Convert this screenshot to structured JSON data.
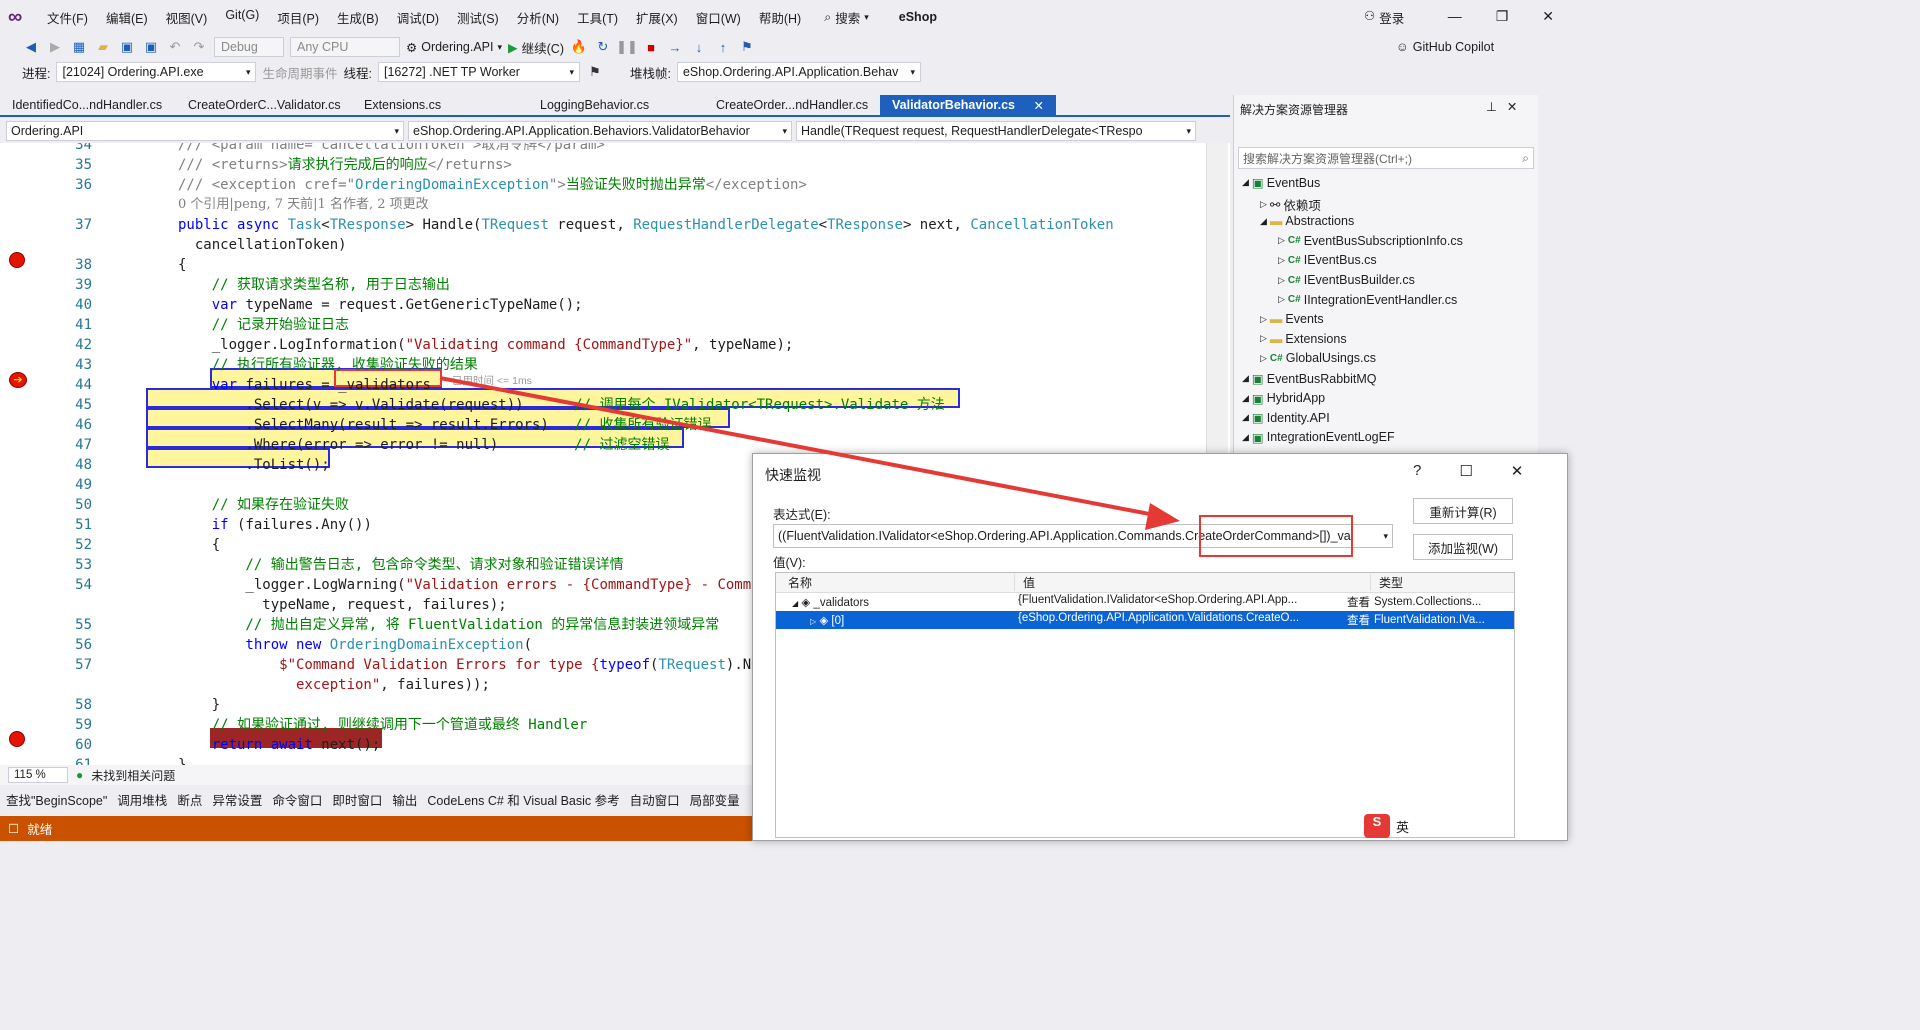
{
  "app": {
    "title": "eShop",
    "login": "登录",
    "copilot": "GitHub Copilot"
  },
  "menu": [
    "文件(F)",
    "编辑(E)",
    "视图(V)",
    "Git(G)",
    "项目(P)",
    "生成(B)",
    "调试(D)",
    "测试(S)",
    "分析(N)",
    "工具(T)",
    "扩展(X)",
    "窗口(W)",
    "帮助(H)"
  ],
  "search_label": "搜索",
  "toolbar": {
    "config": "Debug",
    "platform": "Any CPU",
    "startup": "Ordering.API",
    "continue": "继续(C)"
  },
  "debugbar": {
    "process_label": "进程:",
    "process": "[21024] Ordering.API.exe",
    "lifecycle": "生命周期事件",
    "thread_label": "线程:",
    "thread": "[16272] .NET TP Worker",
    "stack_label": "堆栈帧:",
    "stack": "eShop.Ordering.API.Application.Behav"
  },
  "tabs": [
    "IdentifiedCo...ndHandler.cs",
    "CreateOrderC...Validator.cs",
    "Extensions.cs",
    "LoggingBehavior.cs",
    "CreateOrder...ndHandler.cs",
    "ValidatorBehavior.cs"
  ],
  "nav": {
    "project": "Ordering.API",
    "type": "eShop.Ordering.API.Application.Behaviors.ValidatorBehavior",
    "member": "Handle(TRequest request, RequestHandlerDelegate<TRespo"
  },
  "editor": {
    "lines": [
      {
        "n": "34",
        "segs": [
          [
            "gy",
            "/// <param name=\"cancellationToken\">取消令牌</param>"
          ]
        ]
      },
      {
        "n": "35",
        "segs": [
          [
            "gy",
            "/// <returns>"
          ],
          [
            "cm",
            "请求执行完成后的响应"
          ],
          [
            "gy",
            "</returns>"
          ]
        ]
      },
      {
        "n": "36",
        "segs": [
          [
            "gy",
            "/// <exception cref=\""
          ],
          [
            "ty",
            "OrderingDomainException"
          ],
          [
            "gy",
            "\">"
          ],
          [
            "cm",
            "当验证失败时抛出异常"
          ],
          [
            "gy",
            "</exception>"
          ]
        ]
      },
      {
        "n": "",
        "segs": [
          [
            "gy",
            "0 个引用|peng, 7 天前|1 名作者, 2 项更改"
          ]
        ]
      },
      {
        "n": "37",
        "segs": [
          [
            "kw",
            "public async "
          ],
          [
            "ty",
            "Task"
          ],
          [
            "",
            "<"
          ],
          [
            "ty",
            "TResponse"
          ],
          [
            "",
            "> "
          ],
          [
            "",
            "Handle("
          ],
          [
            "ty",
            "TRequest"
          ],
          [
            "",
            " request, "
          ],
          [
            "ty",
            "RequestHandlerDelegate"
          ],
          [
            "",
            "<"
          ],
          [
            "ty",
            "TResponse"
          ],
          [
            "",
            "> next, "
          ],
          [
            "ty",
            "CancellationToken"
          ]
        ]
      },
      {
        "n": "",
        "segs": [
          [
            "",
            "  cancellationToken)"
          ]
        ]
      },
      {
        "n": "38",
        "segs": [
          [
            "",
            "{"
          ]
        ]
      },
      {
        "n": "39",
        "segs": [
          [
            "cm",
            "    // 获取请求类型名称, 用于日志输出"
          ]
        ]
      },
      {
        "n": "40",
        "segs": [
          [
            "kw",
            "    var "
          ],
          [
            "",
            "typeName = request.GetGenericTypeName();"
          ]
        ]
      },
      {
        "n": "41",
        "segs": [
          [
            "cm",
            "    // 记录开始验证日志"
          ]
        ]
      },
      {
        "n": "42",
        "segs": [
          [
            "",
            "    _logger.LogInformation("
          ],
          [
            "st",
            "\"Validating command {CommandType}\""
          ],
          [
            "",
            ", typeName);"
          ]
        ]
      },
      {
        "n": "43",
        "segs": [
          [
            "cm",
            "    // 执行所有验证器, 收集验证失败的结果"
          ]
        ]
      },
      {
        "n": "44",
        "segs": [
          [
            "kw",
            "    var "
          ],
          [
            "",
            "failures = _validators"
          ]
        ]
      },
      {
        "n": "45",
        "segs": [
          [
            "",
            "        .Select(v => v.Validate(request))      "
          ],
          [
            "cm",
            "// 调用每个 IValidator<TRequest>.Validate 方法"
          ]
        ]
      },
      {
        "n": "46",
        "segs": [
          [
            "",
            "        .SelectMany(result => result.Errors)   "
          ],
          [
            "cm",
            "// 收集所有验证错误"
          ]
        ]
      },
      {
        "n": "47",
        "segs": [
          [
            "",
            "        .Where(error => error != null)         "
          ],
          [
            "cm",
            "// 过滤空错误"
          ]
        ]
      },
      {
        "n": "48",
        "segs": [
          [
            "",
            "        .ToList();"
          ]
        ]
      },
      {
        "n": "49",
        "segs": [
          [
            "",
            ""
          ]
        ]
      },
      {
        "n": "50",
        "segs": [
          [
            "cm",
            "    // 如果存在验证失败"
          ]
        ]
      },
      {
        "n": "51",
        "segs": [
          [
            "kw",
            "    if "
          ],
          [
            "",
            "(failures.Any())"
          ]
        ]
      },
      {
        "n": "52",
        "segs": [
          [
            "",
            "    {"
          ]
        ]
      },
      {
        "n": "53",
        "segs": [
          [
            "cm",
            "        // 输出警告日志, 包含命令类型、请求对象和验证错误详情"
          ]
        ]
      },
      {
        "n": "54",
        "segs": [
          [
            "",
            "        _logger.LogWarning("
          ],
          [
            "st",
            "\"Validation errors - {CommandType} - Comm"
          ]
        ]
      },
      {
        "n": "",
        "segs": [
          [
            "",
            "          typeName, request, failures);"
          ]
        ]
      },
      {
        "n": "55",
        "segs": [
          [
            "cm",
            "        // 抛出自定义异常, 将 FluentValidation 的异常信息封装进领域异常"
          ]
        ]
      },
      {
        "n": "56",
        "segs": [
          [
            "kw",
            "        throw new "
          ],
          [
            "ty",
            "OrderingDomainException"
          ],
          [
            "",
            "("
          ]
        ]
      },
      {
        "n": "57",
        "segs": [
          [
            "st",
            "            $\"Command Validation Errors for type {"
          ],
          [
            "kw",
            "typeof"
          ],
          [
            "",
            "("
          ],
          [
            "ty",
            "TRequest"
          ],
          [
            "",
            ").N"
          ]
        ]
      },
      {
        "n": "",
        "segs": [
          [
            "st",
            "              exception\""
          ],
          [
            "",
            ", failures));"
          ]
        ]
      },
      {
        "n": "58",
        "segs": [
          [
            "",
            "    }"
          ]
        ]
      },
      {
        "n": "59",
        "segs": [
          [
            "cm",
            "    // 如果验证通过, 则继续调用下一个管道或最终 Handler"
          ]
        ]
      },
      {
        "n": "60",
        "segs": [
          [
            "kw",
            "    return await "
          ],
          [
            "",
            "next();"
          ]
        ]
      },
      {
        "n": "61",
        "segs": [
          [
            "",
            "}"
          ]
        ]
      }
    ],
    "elapsed": "已用时间 <= 1ms",
    "zoom": "115 %",
    "issues": "未找到相关问题"
  },
  "solution": {
    "title": "解决方案资源管理器",
    "search_placeholder": "搜索解决方案资源管理器(Ctrl+;)",
    "items": [
      {
        "label": "EventBus",
        "indent": 0,
        "kind": "proj"
      },
      {
        "label": "依赖项",
        "indent": 1,
        "kind": "dep"
      },
      {
        "label": "Abstractions",
        "indent": 1,
        "kind": "folder"
      },
      {
        "label": "EventBusSubscriptionInfo.cs",
        "indent": 2,
        "kind": "cs"
      },
      {
        "label": "IEventBus.cs",
        "indent": 2,
        "kind": "cs"
      },
      {
        "label": "IEventBusBuilder.cs",
        "indent": 2,
        "kind": "cs"
      },
      {
        "label": "IIntegrationEventHandler.cs",
        "indent": 2,
        "kind": "cs"
      },
      {
        "label": "Events",
        "indent": 1,
        "kind": "folder"
      },
      {
        "label": "Extensions",
        "indent": 1,
        "kind": "folder"
      },
      {
        "label": "GlobalUsings.cs",
        "indent": 1,
        "kind": "cs"
      },
      {
        "label": "EventBusRabbitMQ",
        "indent": 0,
        "kind": "proj"
      },
      {
        "label": "HybridApp",
        "indent": 0,
        "kind": "proj"
      },
      {
        "label": "Identity.API",
        "indent": 0,
        "kind": "proj"
      },
      {
        "label": "IntegrationEventLogEF",
        "indent": 0,
        "kind": "proj"
      }
    ]
  },
  "quickwatch": {
    "title": "快速监视",
    "expr_label": "表达式(E):",
    "expression": "((FluentValidation.IValidator<eShop.Ordering.API.Application.Commands.CreateOrderCommand>[])_va",
    "value_label": "值(V):",
    "recalc": "重新计算(R)",
    "addwatch": "添加监视(W)",
    "col_name": "名称",
    "col_value": "值",
    "col_type": "类型",
    "rows": [
      {
        "name": "_validators",
        "value": "{FluentValidation.IValidator<eShop.Ordering.API.App...",
        "view": "查看",
        "type": "System.Collections..."
      },
      {
        "name": "[0]",
        "value": "{eShop.Ordering.API.Application.Validations.CreateO...",
        "view": "查看",
        "type": "FluentValidation.IVa..."
      }
    ],
    "highlight": "CreateOrderCommand"
  },
  "bottomtabs": [
    "查找\"BeginScope\"",
    "调用堆栈",
    "断点",
    "异常设置",
    "命令窗口",
    "即时窗口",
    "输出",
    "CodeLens C# 和 Visual Basic 参考",
    "自动窗口",
    "局部变量"
  ],
  "status": "就绪",
  "ime": "英"
}
